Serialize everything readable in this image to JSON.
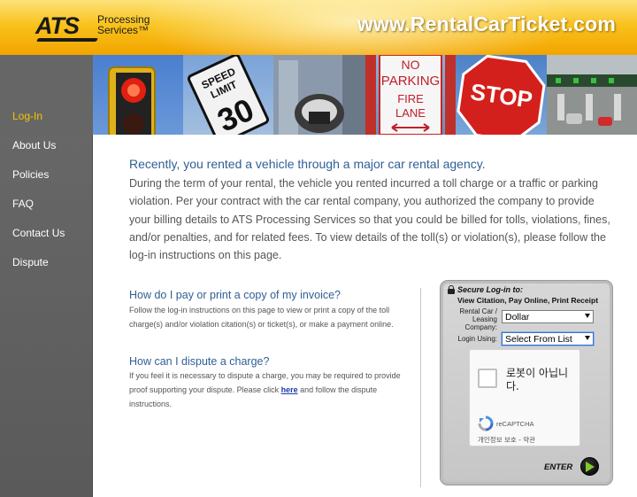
{
  "header": {
    "logo_text": "ATS",
    "logo_subtext_line1": "Processing",
    "logo_subtext_line2": "Services™",
    "site_url": "www.RentalCarTicket.com"
  },
  "sidebar": {
    "items": [
      {
        "label": "Log-In",
        "active": true
      },
      {
        "label": "About Us",
        "active": false
      },
      {
        "label": "Policies",
        "active": false
      },
      {
        "label": "FAQ",
        "active": false
      },
      {
        "label": "Contact Us",
        "active": false
      },
      {
        "label": "Dispute",
        "active": false
      }
    ]
  },
  "photos": {
    "speed_sign_line1": "SPEED",
    "speed_sign_line2": "LIMIT",
    "speed_sign_value": "30",
    "no_parking_line1": "NO",
    "no_parking_line2": "PARKING",
    "no_parking_line3": "FIRE",
    "no_parking_line4": "LANE",
    "stop_sign": "STOP"
  },
  "main": {
    "intro_title": "Recently, you rented a vehicle through a major car rental agency.",
    "intro_body": "During the term of your rental, the vehicle you rented incurred a toll charge or a traffic or parking violation. Per your contract with the car rental company, you authorized the company to provide your billing details to ATS Processing Services so that you could be billed for tolls, violations, fines, and/or penalties, and for related fees. To view details of the toll(s) or violation(s), please follow the log-in instructions on this page.",
    "q1_title": "How do I pay or print a copy of my invoice?",
    "q1_body": "Follow the log-in instructions on this page to view or print a copy of the toll charge(s) and/or violation citation(s) or ticket(s), or make a payment online.",
    "q2_title": "How can I dispute a charge?",
    "q2_body_before": "If you feel it is necessary to dispute a charge, you may be required to provide proof supporting your dispute. Please click ",
    "q2_link": "here",
    "q2_body_after": " and follow the dispute instructions."
  },
  "login": {
    "title": "Secure Log-in to:",
    "subtitle": "View Citation, Pay Online, Print Receipt",
    "company_label_line1": "Rental Car /",
    "company_label_line2": "Leasing",
    "company_label_line3": "Company:",
    "company_value": "Dollar",
    "login_using_label": "Login Using:",
    "login_using_value": "Select From List",
    "enter_label": "ENTER"
  },
  "captcha": {
    "checkbox_text": "로봇이 아닙니다.",
    "brand": "reCAPTCHA",
    "terms": "개인정보 보호 - 약관"
  },
  "colors": {
    "header_yellow": "#f9c21c",
    "sidebar_gray": "#5f5f5f",
    "active_nav": "#f5c400",
    "heading_blue": "#2f5f96",
    "enter_green": "#7fc92a"
  }
}
